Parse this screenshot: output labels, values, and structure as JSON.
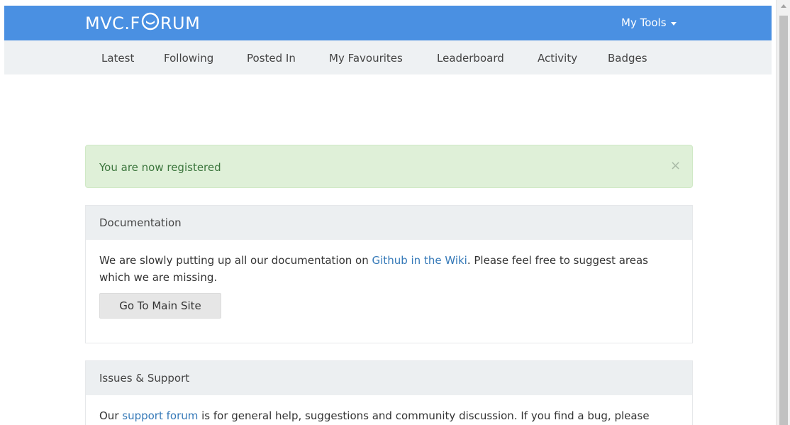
{
  "header": {
    "logo_prefix": "MVC.F",
    "logo_suffix": "RUM",
    "tools_label": "My Tools",
    "brand_color": "#4a90e2"
  },
  "nav": {
    "items": [
      {
        "label": "Latest"
      },
      {
        "label": "Following"
      },
      {
        "label": "Posted In"
      },
      {
        "label": "My Favourites"
      },
      {
        "label": "Leaderboard"
      },
      {
        "label": "Activity"
      },
      {
        "label": "Badges"
      }
    ]
  },
  "alert": {
    "text": "You are now registered",
    "close": "×"
  },
  "documentation": {
    "title": "Documentation",
    "text_before": "We are slowly putting up all our documentation on ",
    "link": "Github in the Wiki",
    "text_after": ". Please feel free to suggest areas which we are missing.",
    "button": "Go To Main Site"
  },
  "support": {
    "title": "Issues & Support",
    "text_before": "Our ",
    "link": "support forum",
    "text_after": " is for general help, suggestions and community discussion. If you find a bug, please"
  }
}
